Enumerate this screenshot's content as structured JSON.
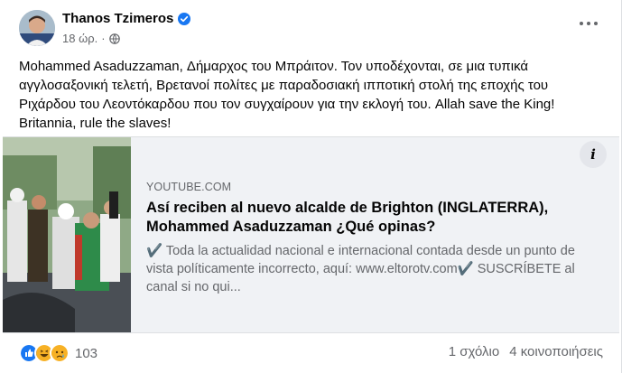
{
  "post": {
    "author": "Thanos Tzimeros",
    "time": "18 ώρ.",
    "text": "Mohammed Asaduzzaman, Δήμαρχος του Μπράιτον. Τον υποδέχονται, σε μια τυπικά αγγλοσαξονική τελετή, Βρετανοί πολίτες με παραδοσιακή ιπποτική στολή της εποχής του Ριχάρδου του Λεοντόκαρδου που τον συγχαίρουν για την εκλογή του. Allah save the King! Britannia, rule the slaves!"
  },
  "link": {
    "domain": "YOUTUBE.COM",
    "title": "Así reciben al nuevo alcalde de Brighton (INGLATERRA), Mohammed Asaduzzaman ¿Qué opinas?",
    "description": "✔️ Toda la actualidad nacional e internacional contada desde un punto de vista políticamente incorrecto, aquí: www.eltorotv.com✔️ SUSCRÍBETE al canal si no qui...",
    "info_glyph": "i"
  },
  "footer": {
    "reaction_count": "103",
    "comments": "1 σχόλιο",
    "shares": "4 κοινοποιήσεις"
  },
  "icons": {
    "verified": "verified-badge-icon",
    "globe": "globe-icon",
    "more": "more-options-icon",
    "reactions": [
      "like-reaction-icon",
      "haha-reaction-icon",
      "sad-reaction-icon"
    ]
  },
  "colors": {
    "link_blue": "#1877f2",
    "secondary_text": "#65676b",
    "preview_bg": "#f0f2f5"
  }
}
